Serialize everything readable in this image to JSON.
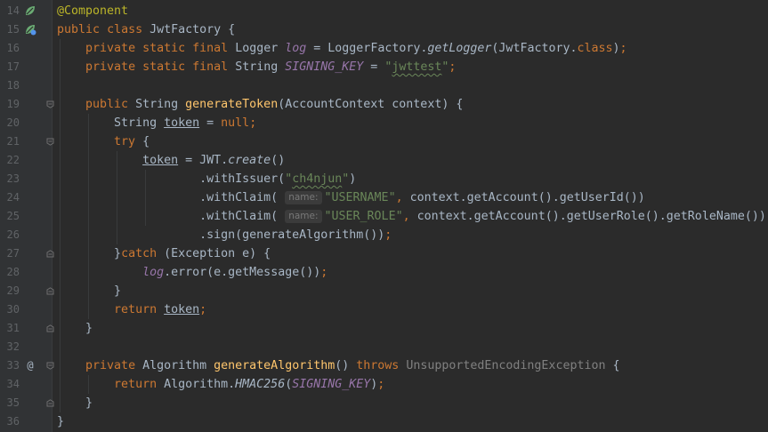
{
  "editor": {
    "lines": [
      {
        "n": "14",
        "t": "@Component"
      },
      {
        "n": "15",
        "t": "public class JwtFactory {"
      },
      {
        "n": "16",
        "t": "    private static final Logger log = LoggerFactory.getLogger(JwtFactory.class);"
      },
      {
        "n": "17",
        "t": "    private static final String SIGNING_KEY = \"jwttest\";"
      },
      {
        "n": "18",
        "t": ""
      },
      {
        "n": "19",
        "t": "    public String generateToken(AccountContext context) {"
      },
      {
        "n": "20",
        "t": "        String token = null;"
      },
      {
        "n": "21",
        "t": "        try {"
      },
      {
        "n": "22",
        "t": "            token = JWT.create()"
      },
      {
        "n": "23",
        "t": "                    .withIssuer(\"ch4njun\")"
      },
      {
        "n": "24",
        "t": "                    .withClaim( name: \"USERNAME\", context.getAccount().getUserId())"
      },
      {
        "n": "25",
        "t": "                    .withClaim( name: \"USER_ROLE\", context.getAccount().getUserRole().getRoleName())"
      },
      {
        "n": "26",
        "t": "                    .sign(generateAlgorithm());"
      },
      {
        "n": "27",
        "t": "        }catch (Exception e) {"
      },
      {
        "n": "28",
        "t": "            log.error(e.getMessage());"
      },
      {
        "n": "29",
        "t": "        }"
      },
      {
        "n": "30",
        "t": "        return token;"
      },
      {
        "n": "31",
        "t": "    }"
      },
      {
        "n": "32",
        "t": ""
      },
      {
        "n": "33",
        "t": "    private Algorithm generateAlgorithm() throws UnsupportedEncodingException {"
      },
      {
        "n": "34",
        "t": "        return Algorithm.HMAC256(SIGNING_KEY);"
      },
      {
        "n": "35",
        "t": "    }"
      },
      {
        "n": "36",
        "t": "}"
      }
    ],
    "gutter_icons": {
      "14": "spring-bean-icon",
      "15": "spring-bean-icon",
      "33": "at-icon"
    },
    "colors": {
      "background": "#2b2b2b",
      "gutter": "#313335",
      "keyword": "#cc7832",
      "annotation": "#bbb529",
      "string": "#6a8759",
      "method_declaration": "#ffc66d",
      "field": "#9876aa",
      "text": "#a9b7c6",
      "line_number": "#606366"
    }
  }
}
